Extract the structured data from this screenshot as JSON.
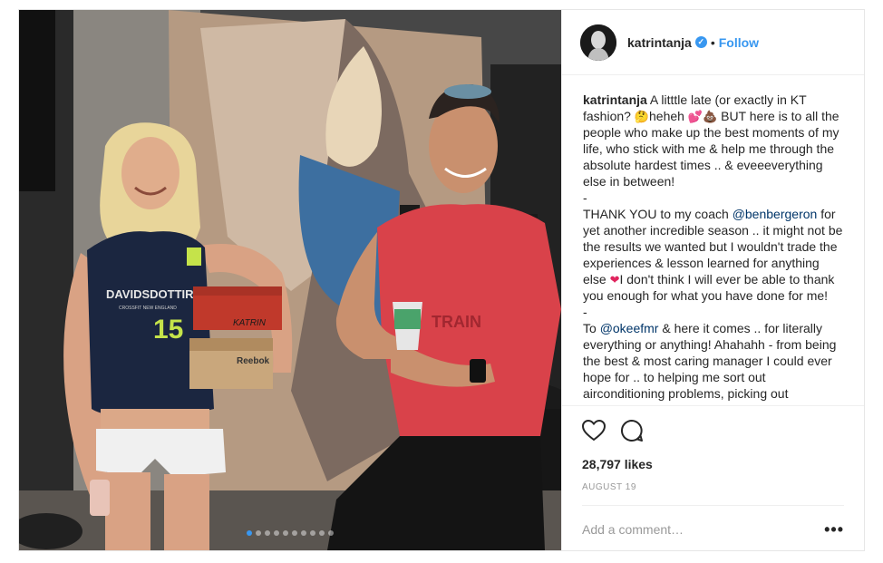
{
  "post": {
    "username": "katrintanja",
    "verified": true,
    "separator": "•",
    "follow_label": "Follow"
  },
  "caption": {
    "username": "katrintanja",
    "part1": " A litttle late (or exactly in KT fashion? ",
    "emoji1": "🤔",
    "part2": "heheh ",
    "emoji2": "💕💩",
    "part3": " BUT here is to all the people who make up the best moments of my life, who stick with me & help me through the absolute hardest times .. & eveeeverything else in between!\n-\nTHANK YOU to my coach ",
    "mention1": "@benbergeron",
    "part4": " for yet another incredible season .. it might not be the results we wanted but I wouldn't trade the experiences & lesson learned for anything else ",
    "emoji3": "❤",
    "part5": "I don't think I will ever be able to thank you enough for what you have done for me!\n-\nTo ",
    "mention2": "@okeefmr",
    "part6": " & here it comes .. for literally everything or anything! Ahahahh - from being the best & most caring manager I could ever hope for .. to helping me sort out airconditioning problems, picking out"
  },
  "photo": {
    "shirt_text": "DAVIDSDOTTIR",
    "shirt_sub": "CROSSFIT NEW ENGLAND",
    "shirt_number": "15",
    "box_label": "KATRIN",
    "box_brand": "Reebok",
    "tee_text": "TRAIN",
    "slide_count": 10,
    "active_slide": 0
  },
  "engagement": {
    "likes": "28,797 likes",
    "date": "AUGUST 19"
  },
  "comment": {
    "placeholder": "Add a comment…",
    "more_label": "•••"
  },
  "icons": {
    "like": "heart-icon",
    "comment": "comment-icon",
    "verified": "verified-badge-icon",
    "more": "more-options-icon"
  },
  "colors": {
    "accent": "#3897f0",
    "text": "#262626",
    "muted": "#999999",
    "border": "#efefef"
  }
}
